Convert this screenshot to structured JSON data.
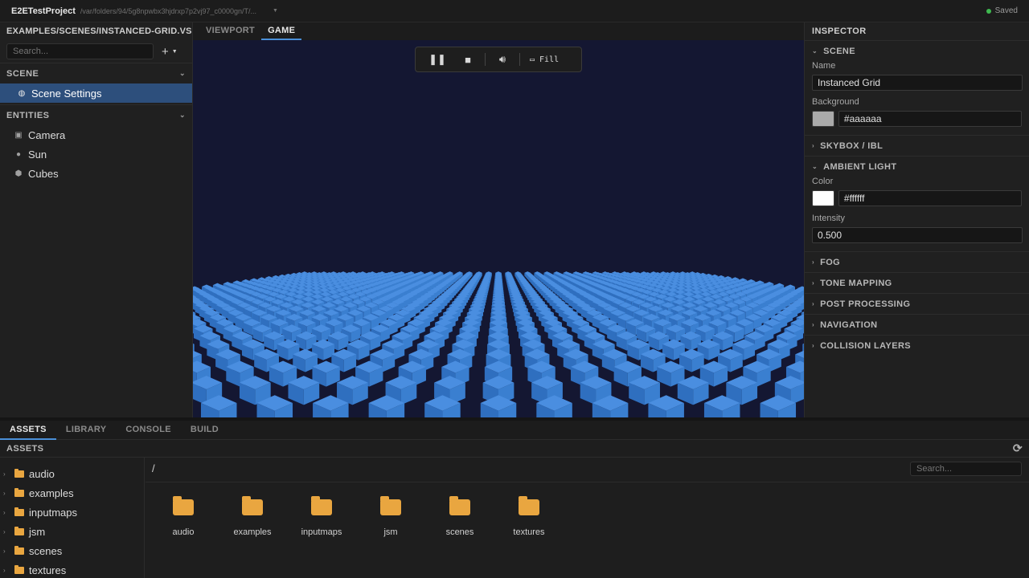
{
  "titlebar": {
    "project": "E2ETestProject",
    "path": "/var/folders/94/5g8npwbx3hjdrxp7p2vj97_c0000gn/T/...",
    "status": "Saved"
  },
  "left": {
    "file_path": "EXAMPLES/SCENES/INSTANCED-GRID.VSCN",
    "search_placeholder": "Search...",
    "add_label": "+",
    "scene_header": "SCENE",
    "scene_item": "Scene Settings",
    "entities_header": "ENTITIES",
    "entities": [
      {
        "label": "Camera",
        "icon": "camera-icon"
      },
      {
        "label": "Sun",
        "icon": "light-icon"
      },
      {
        "label": "Cubes",
        "icon": "cube-icon"
      }
    ]
  },
  "center": {
    "tabs": [
      "VIEWPORT",
      "GAME"
    ],
    "active_tab": "GAME",
    "fill_label": "Fill"
  },
  "inspector": {
    "title": "INSPECTOR",
    "scene_header": "SCENE",
    "name_label": "Name",
    "name_value": "Instanced Grid",
    "background_label": "Background",
    "background_value": "#aaaaaa",
    "background_color": "#aaaaaa",
    "skybox_header": "SKYBOX / IBL",
    "ambient_header": "AMBIENT LIGHT",
    "color_label": "Color",
    "color_value": "#ffffff",
    "color_swatch": "#ffffff",
    "intensity_label": "Intensity",
    "intensity_value": "0.500",
    "collapsed_sections": [
      "FOG",
      "TONE MAPPING",
      "POST PROCESSING",
      "NAVIGATION",
      "COLLISION LAYERS"
    ]
  },
  "bottom": {
    "tabs": [
      "ASSETS",
      "LIBRARY",
      "CONSOLE",
      "BUILD"
    ],
    "active_tab": "ASSETS",
    "assets_header": "ASSETS",
    "breadcrumb": "/",
    "search_placeholder": "Search...",
    "folders": [
      "audio",
      "examples",
      "inputmaps",
      "jsm",
      "scenes",
      "textures"
    ]
  },
  "colors": {
    "accent": "#4a8fd8",
    "selection": "#2d4f7c",
    "folder": "#e9a640",
    "cube": "#3a7fd0",
    "viewport_bg": "#141732",
    "saved_dot": "#3fb950"
  }
}
